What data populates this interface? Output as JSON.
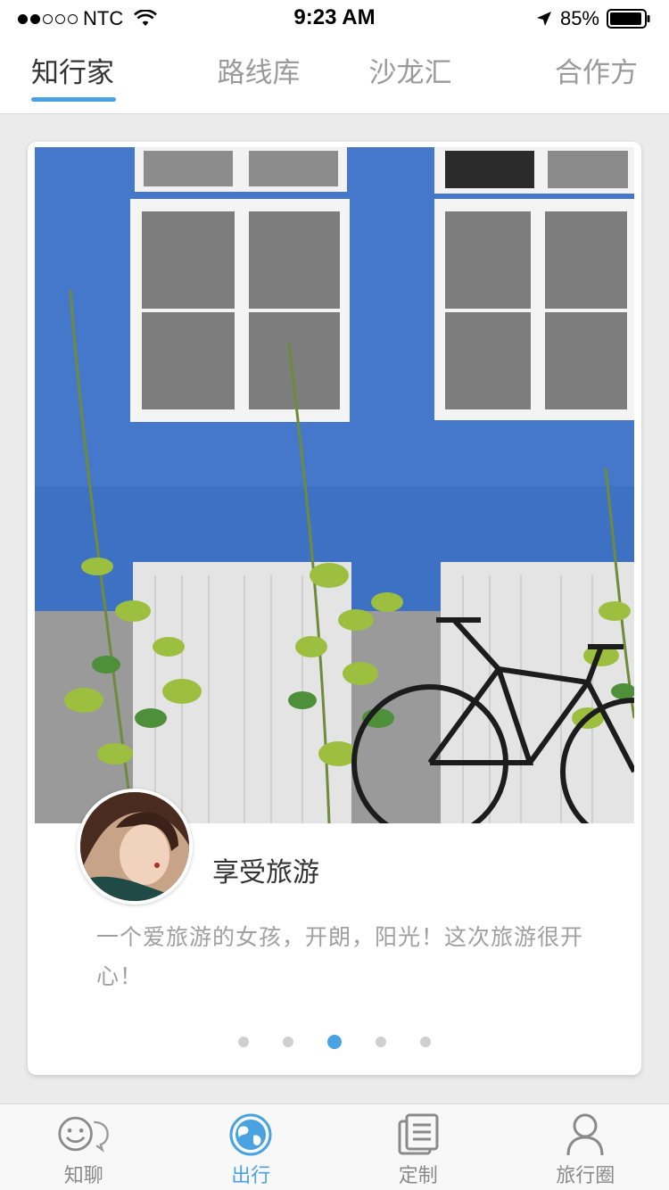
{
  "status_bar": {
    "carrier": "NTC",
    "time": "9:23 AM",
    "battery": "85%",
    "signal_strength": 2,
    "icons": [
      "signal-dots",
      "wifi-icon",
      "location-arrow-icon",
      "battery-icon"
    ]
  },
  "top_tabs": [
    {
      "label": "知行家",
      "active": true
    },
    {
      "label": "路线库",
      "active": false
    },
    {
      "label": "沙龙汇",
      "active": false
    },
    {
      "label": "合作方",
      "active": false
    }
  ],
  "card": {
    "username": "享受旅游",
    "bio": "一个爱旅游的女孩，开朗，阳光！这次旅游很开心！",
    "pager": {
      "count": 5,
      "active_index": 2
    }
  },
  "bottom_nav": [
    {
      "label": "知聊",
      "icon": "chat-smile-icon",
      "active": false
    },
    {
      "label": "出行",
      "icon": "globe-icon",
      "active": true
    },
    {
      "label": "定制",
      "icon": "document-icon",
      "active": false
    },
    {
      "label": "旅行圈",
      "icon": "person-icon",
      "active": false
    }
  ],
  "colors": {
    "accent": "#4aa3e0",
    "background": "#ebebeb",
    "wall_blue": "#3e72c7",
    "inactive_text": "#9a9a9a"
  }
}
